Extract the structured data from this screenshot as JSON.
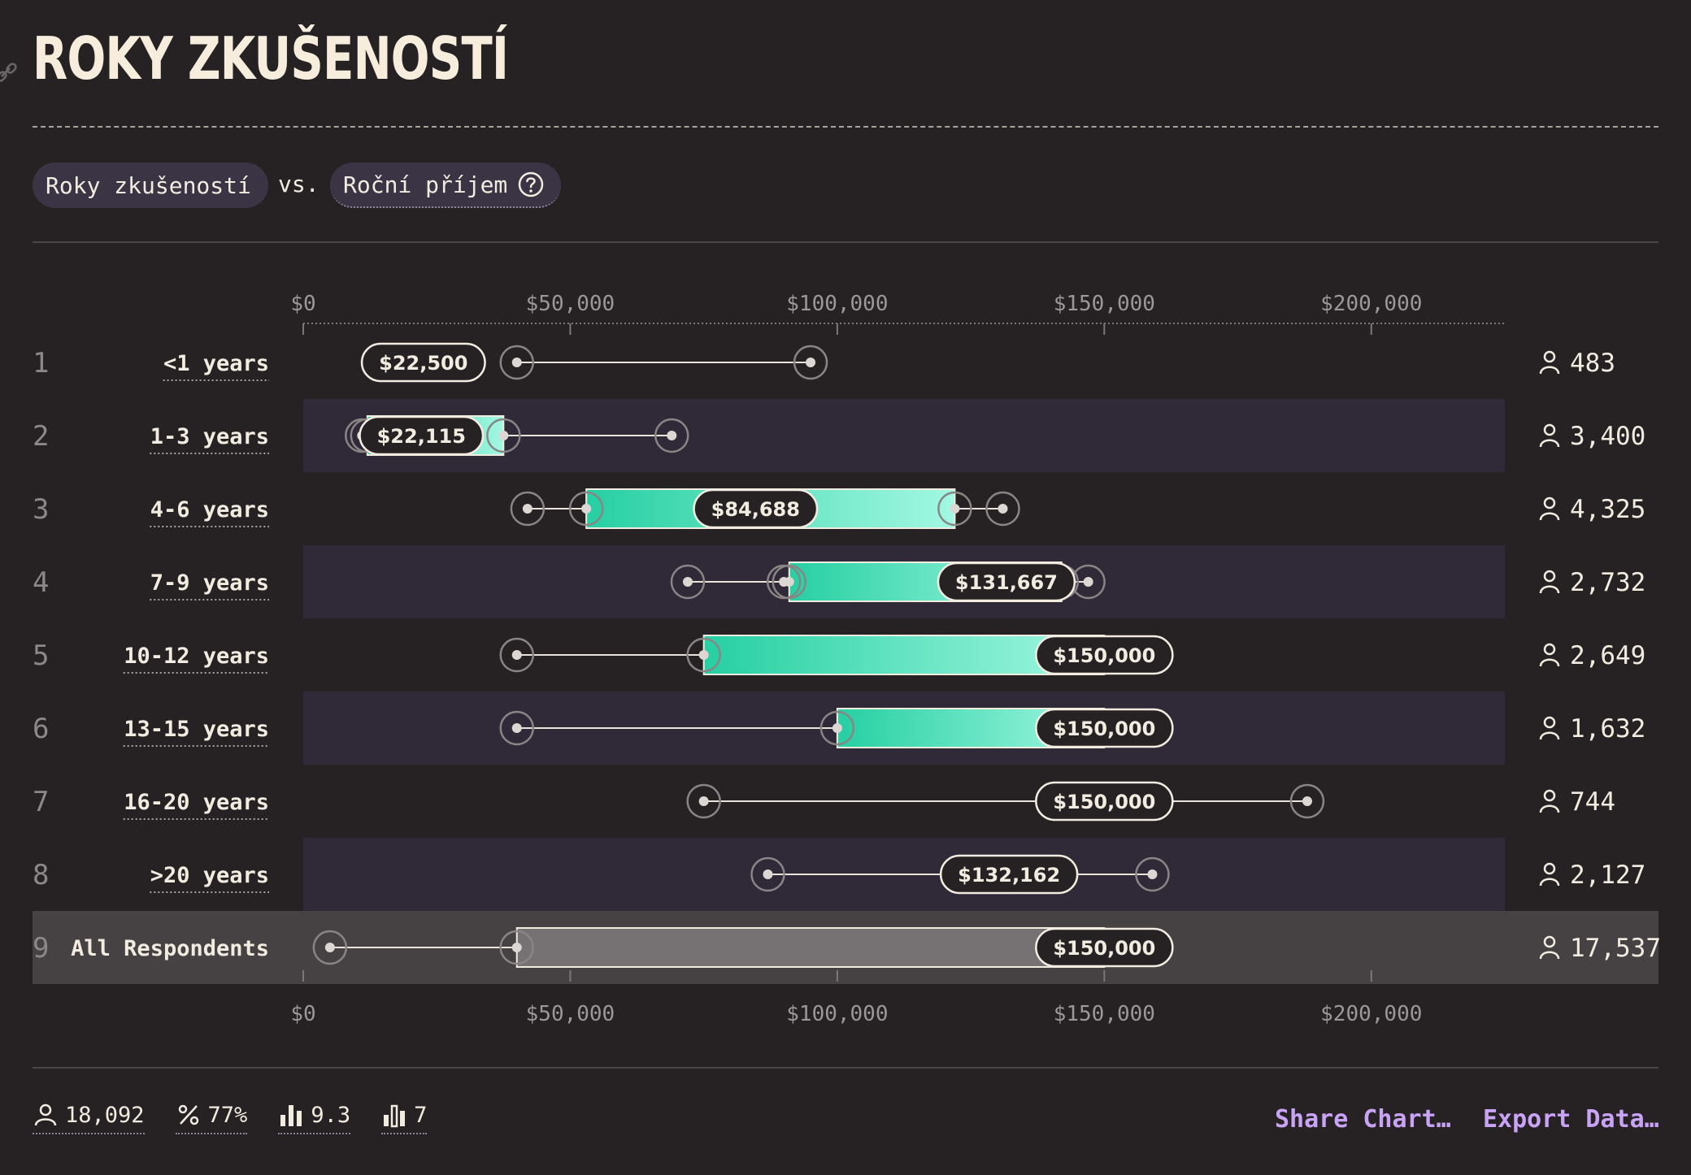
{
  "page": {
    "title": "ROKY ZKUŠENOSTÍ",
    "x_selector": "Roky zkušeností",
    "vs": "vs.",
    "y_selector": "Roční příjem"
  },
  "chart_data": {
    "type": "box",
    "x_axis": {
      "min": 0,
      "max": 225000,
      "ticks": [
        0,
        50000,
        100000,
        150000,
        200000
      ],
      "tick_labels": [
        "$0",
        "$50,000",
        "$100,000",
        "$150,000",
        "$200,000"
      ]
    },
    "rows": [
      {
        "index": "1",
        "label": "<1 years",
        "count": "483",
        "outer_low": null,
        "whisker_low": 40000,
        "q1": 40000,
        "median": 22500,
        "median_label": "$22,500",
        "q3": 40000,
        "whisker_high": 95000,
        "median_visible": true,
        "capped": false
      },
      {
        "index": "2",
        "label": "1-3 years",
        "count": "3,400",
        "outer_low": 11000,
        "whisker_low": 11000,
        "q1": 12000,
        "median": 22115,
        "median_label": "$22,115",
        "q3": 37500,
        "whisker_high": 69000,
        "median_visible": true,
        "capped": false
      },
      {
        "index": "3",
        "label": "4-6 years",
        "count": "4,325",
        "outer_low": 42000,
        "whisker_low": 53000,
        "q1": 53000,
        "median": 84688,
        "median_label": "$84,688",
        "q3": 122000,
        "whisker_high": 131000,
        "median_visible": true,
        "capped": false
      },
      {
        "index": "4",
        "label": "7-9 years",
        "count": "2,732",
        "outer_low": 72000,
        "whisker_low": 90000,
        "q1": 91000,
        "median": 131667,
        "median_label": "$131,667",
        "q3": 142000,
        "whisker_high": 147000,
        "median_visible": true,
        "capped": false
      },
      {
        "index": "5",
        "label": "10-12 years",
        "count": "2,649",
        "outer_low": 40000,
        "whisker_low": 75000,
        "q1": 75000,
        "median": 150000,
        "median_label": "$150,000",
        "q3": 150000,
        "whisker_high": 150000,
        "median_visible": true,
        "capped": true
      },
      {
        "index": "6",
        "label": "13-15 years",
        "count": "1,632",
        "outer_low": 40000,
        "whisker_low": 100000,
        "q1": 100000,
        "median": 150000,
        "median_label": "$150,000",
        "q3": 150000,
        "whisker_high": 150000,
        "median_visible": true,
        "capped": true
      },
      {
        "index": "7",
        "label": "16-20 years",
        "count": "744",
        "outer_low": null,
        "whisker_low": 75000,
        "q1": null,
        "median": 150000,
        "median_label": "$150,000",
        "q3": null,
        "whisker_high": 188000,
        "median_visible": true,
        "capped": true
      },
      {
        "index": "8",
        "label": ">20 years",
        "count": "2,127",
        "outer_low": null,
        "whisker_low": 87000,
        "q1": 124000,
        "median": 132162,
        "median_label": "$132,162",
        "q3": 124000,
        "whisker_high": 159000,
        "median_visible": true,
        "capped": false
      },
      {
        "index": "9",
        "label": "All Respondents",
        "count": "17,537",
        "outer_low": 5000,
        "whisker_low": 5000,
        "q1": 40000,
        "median": 150000,
        "median_label": "$150,000",
        "q3": 150000,
        "whisker_high": 150000,
        "median_visible": true,
        "capped": true
      }
    ]
  },
  "footer": {
    "stats": [
      {
        "icon": "person-icon",
        "value": "18,092"
      },
      {
        "icon": "percent-icon",
        "value": "77%"
      },
      {
        "icon": "bar-chart-icon",
        "value": "9.3"
      },
      {
        "icon": "bar-chart-outline-icon",
        "value": "7"
      }
    ],
    "share_label": "Share Chart…",
    "export_label": "Export Data…"
  },
  "colors": {
    "background": "#262223",
    "band": "#302a38",
    "highlight_band": "#464142",
    "box_start": "#26cfa2",
    "box_end": "#a3f8e2",
    "accent_link": "#c9a3f5"
  }
}
